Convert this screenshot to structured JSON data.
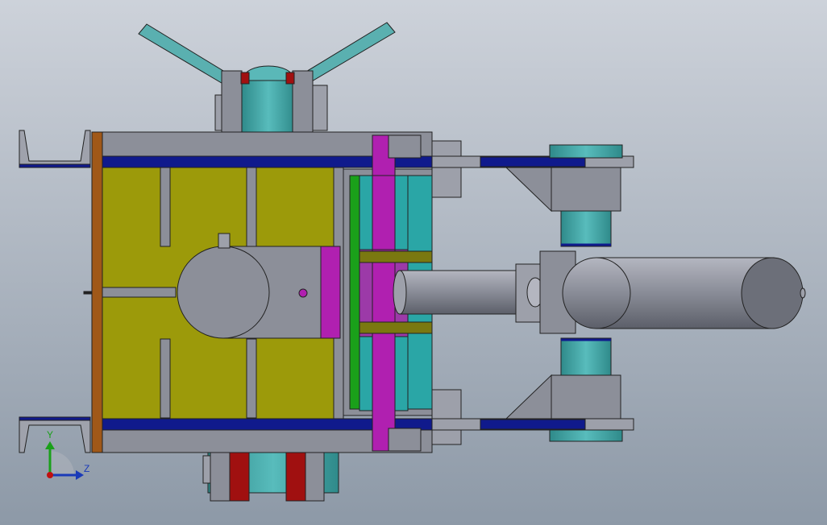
{
  "triad": {
    "y_label": "Y",
    "z_label": "Z"
  },
  "colors": {
    "background_top": "#c9ced6",
    "background_bottom": "#8e9aa8",
    "steel": "#8c8f99",
    "steel_light": "#a0a3ad",
    "olive_plate": "#9c9a0a",
    "blue_rail": "#101a8c",
    "teal": "#46a8a8",
    "magenta": "#b020b0",
    "green_strip": "#1aa01a",
    "brown_plate": "#a05818",
    "red_block": "#a01010",
    "outline": "#222222"
  }
}
